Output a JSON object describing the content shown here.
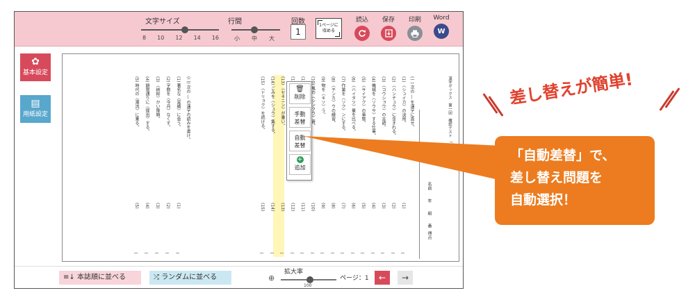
{
  "toolbar": {
    "font_size_label": "文字サイズ",
    "font_size_ticks": [
      "8",
      "10",
      "12",
      "14",
      "16"
    ],
    "font_size_value": 12,
    "line_spacing_label": "行間",
    "line_spacing_ticks": [
      "小",
      "中",
      "大"
    ],
    "line_spacing_value": "中",
    "count_label": "回数",
    "count_value": "1",
    "fit_page_line1": "1ページに",
    "fit_page_line2": "収める",
    "load_label": "読込",
    "save_label": "保存",
    "print_label": "印刷",
    "word_label": "Word",
    "word_icon_text": "W"
  },
  "sidebar": {
    "basic_settings": "基本設定",
    "paper_settings": "用紙設定"
  },
  "document": {
    "header_text": "漢字ボックス　第一回　確認テスト　「一　年",
    "name_row": "名前　　年　　組　　番",
    "score_label": "得点",
    "instruction_1": "(一) 次の ― を漢字に直せ。",
    "instruction_2": "(二) 次の ― の漢字の読みを書け。",
    "questions_1": [
      "(1) 〈シュイカ〉の決用。",
      "(2) 〈ハンチュウ〉に含まれる。",
      "(3) 〈コウショウ〉の言語。",
      "(4) 機械を〈ソウサ〉する仕事。",
      "(5) 〈サイアク〉の事態。",
      "(6) 〈ハイタツ〉量を比べる。",
      "(7) 作業を〈ソク〉ンにする。",
      "(8) 〈テンカ〉ウの練習。",
      "(9) 物を〈キソ〉う。",
      "(10) 風の〈シンクウ〉管。",
      "(11) 〈ジュンビ〉する。",
      "(12) 〈ケイカイ〉の精神。",
      "(13) 〈セキニン〉が重い。",
      "(14) ごみを〈シュウ〉集する。",
      "(15) 〈ドリョク〉を続ける。"
    ],
    "questions_2": [
      "(1) 著名な〈実績〉に会う。",
      "(2) 字数を〈今月〉なくす。",
      "(3) 〈純粋〉かい降順。",
      "(4) 期限通りに〈提出〉する。",
      "(5) 時代の〈潮流〉に乗る。"
    ],
    "answer_numbers_1": [
      "(1)",
      "(2)",
      "(3)",
      "(4)",
      "(5)",
      "(6)",
      "(7)",
      "(8)",
      "(9)",
      "(10)",
      "(11)",
      "(12)",
      "(13)",
      "(14)",
      "(15)"
    ],
    "answer_numbers_2": [
      "(1)",
      "(2)",
      "(3)",
      "(4)",
      "(5)"
    ]
  },
  "popup": {
    "delete_label": "削除",
    "manual_replace_label": "手動\n差替",
    "auto_replace_label": "自動\n差替",
    "add_label": "追加"
  },
  "bottom": {
    "sort_textbook": "本誌順に並べる",
    "sort_random": "ランダムに並べる",
    "zoom_label": "拡大率",
    "zoom_value": "100",
    "page_label": "ページ：1"
  },
  "callout": {
    "banner": "差し替えが簡単!",
    "line1": "「自動差替」で、",
    "line2": "差し替え問題を",
    "line3": "自動選択！"
  },
  "colors": {
    "toolbar_bg": "#f6c9d0",
    "accent_red": "#d74a5b",
    "accent_blue": "#58a7cc",
    "callout_orange": "#ec7c1f",
    "banner_red": "#e0422f",
    "highlight_yellow": "#fff6b8"
  }
}
